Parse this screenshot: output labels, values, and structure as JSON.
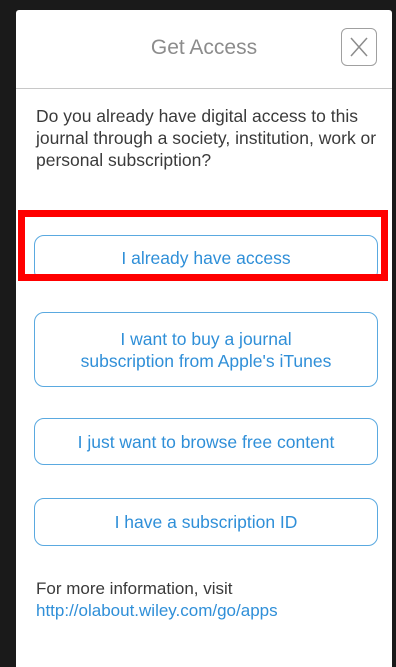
{
  "dialog": {
    "title": "Get Access",
    "close_label": "X",
    "question": "Do you already have digital access to this journal through a society, institution, work or personal subscription?"
  },
  "options": {
    "already_have_access": "I already have access",
    "buy_itunes_line1": "I want to buy a journal",
    "buy_itunes_line2": "subscription from Apple's iTunes",
    "browse_free": "I just want to browse free content",
    "subscription_id": "I have a subscription ID"
  },
  "footer": {
    "info_text": "For more information, visit",
    "link_text": "http://olabout.wiley.com/go/apps"
  },
  "colors": {
    "accent": "#2f8fd8",
    "button_border": "#5aa9e0",
    "highlight": "#ff0000",
    "backdrop": "#1a1a1a"
  }
}
